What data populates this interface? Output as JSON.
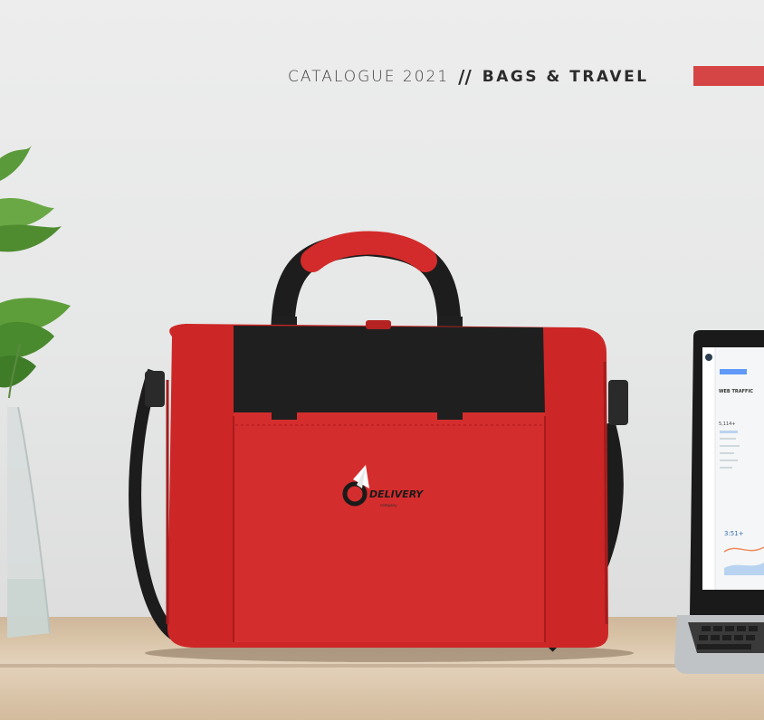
{
  "header": {
    "catalogue": "CATALOGUE 2021",
    "separator": "//",
    "section": "BAGS & TRAVEL"
  },
  "bag_logo": {
    "brand": "DELIVERY",
    "tagline": "company"
  },
  "laptop_screen": {
    "title": "WEB TRAFFIC",
    "stat_1": "5,114+",
    "stat_2": "3:51+"
  },
  "colors": {
    "accent": "#d64545",
    "bag_red": "#d12a2a",
    "bag_black": "#1f1f1f"
  }
}
